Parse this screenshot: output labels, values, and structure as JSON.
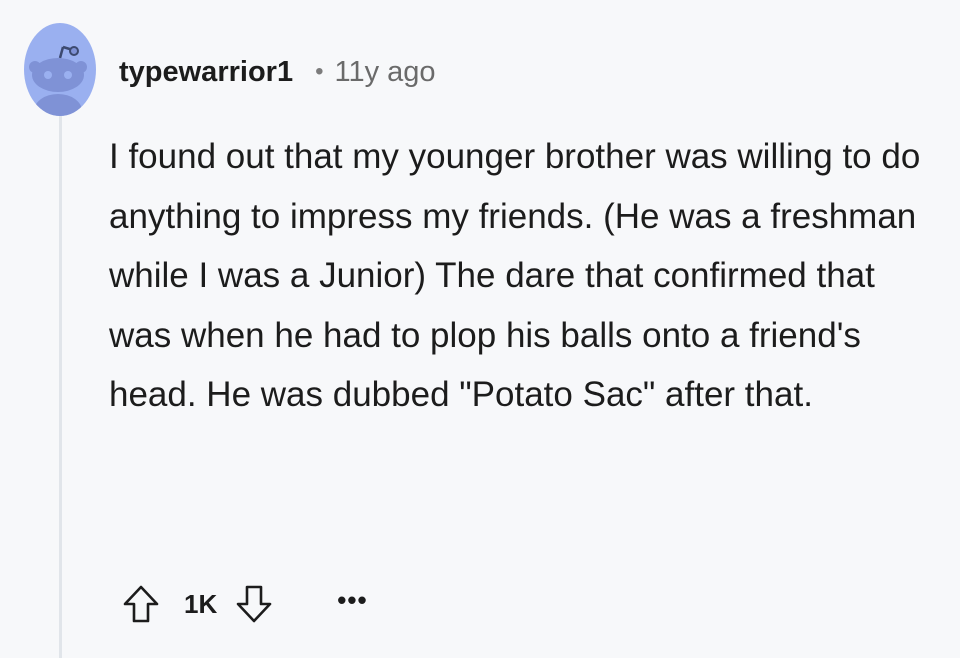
{
  "comment": {
    "username": "typewarrior1",
    "separator": "•",
    "time": "11y ago",
    "body": "I found out that my younger brother was willing to do anything to impress my friends. (He was a freshman while I was a Junior) The dare that confirmed that was when he had to plop his balls onto a friend's head. He was dubbed \"Potato Sac\" after that.",
    "score": "1K",
    "more_label": "•••"
  },
  "icons": {
    "avatar": "snoo-avatar-icon",
    "upvote": "upvote-arrow-icon",
    "downvote": "downvote-arrow-icon",
    "more": "more-options-icon"
  },
  "colors": {
    "background": "#f7f8fa",
    "avatar_bg": "#9ab0f0",
    "text": "#1c1c1c",
    "meta": "#6a6a6a",
    "thread_line": "#e1e5ea"
  }
}
